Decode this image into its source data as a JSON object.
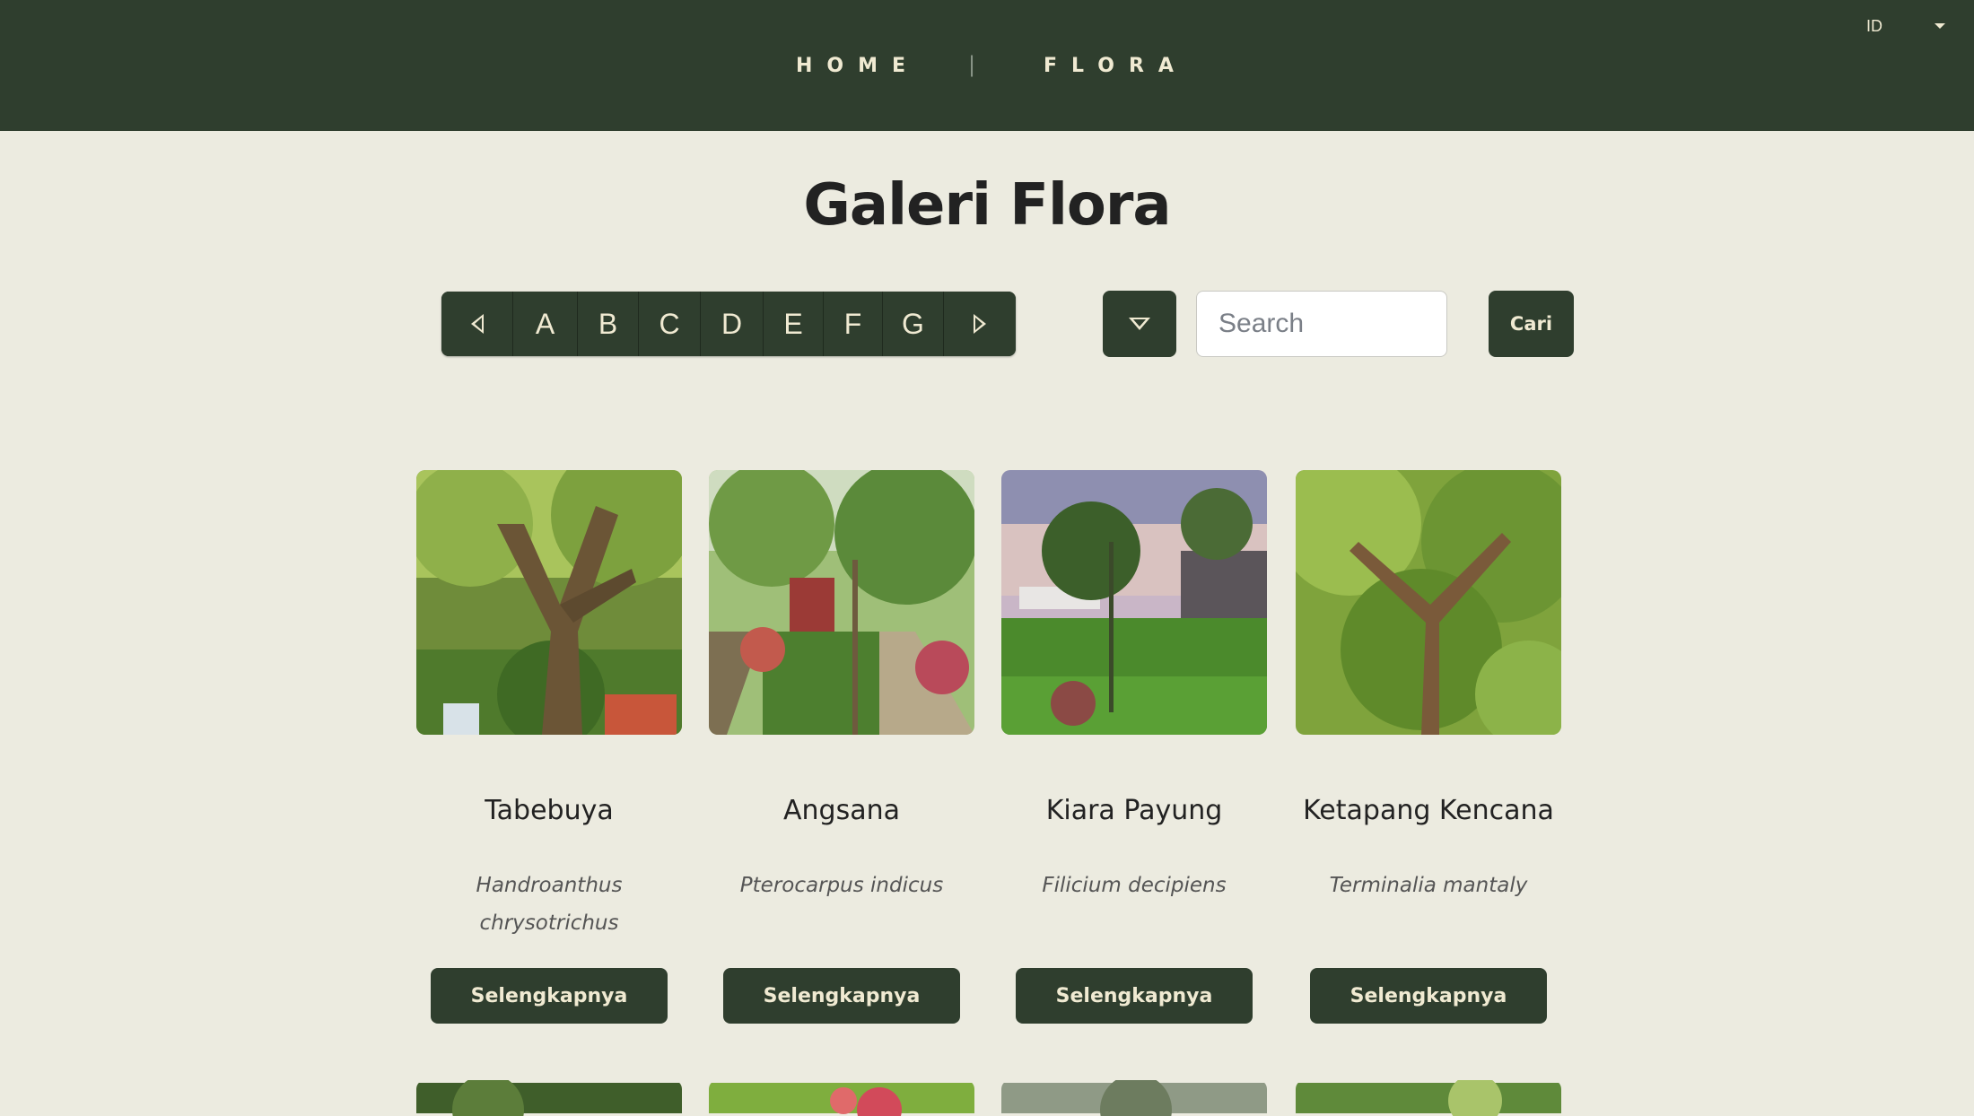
{
  "nav": {
    "home": "HOME",
    "separator": "|",
    "flora": "FLORA",
    "language": "ID"
  },
  "page": {
    "title": "Galeri Flora"
  },
  "alphabet": {
    "prev_icon": "triangle-left-icon",
    "letters": [
      "A",
      "B",
      "C",
      "D",
      "E",
      "F",
      "G"
    ],
    "next_icon": "triangle-right-icon"
  },
  "search": {
    "filter_icon": "triangle-down-icon",
    "placeholder": "Search",
    "value": "",
    "button": "Cari"
  },
  "cards": [
    {
      "name": "Tabebuya",
      "scientific": "Handroanthus chrysotrichus",
      "button": "Selengkapnya"
    },
    {
      "name": "Angsana",
      "scientific": "Pterocarpus indicus",
      "button": "Selengkapnya"
    },
    {
      "name": "Kiara Payung",
      "scientific": "Filicium decipiens",
      "button": "Selengkapnya"
    },
    {
      "name": "Ketapang Kencana",
      "scientific": "Terminalia mantaly",
      "button": "Selengkapnya"
    }
  ],
  "colors": {
    "header": "#2f3e2e",
    "background": "#ecebe0",
    "button": "#2f3e2e",
    "button_text": "#f0ead2"
  }
}
